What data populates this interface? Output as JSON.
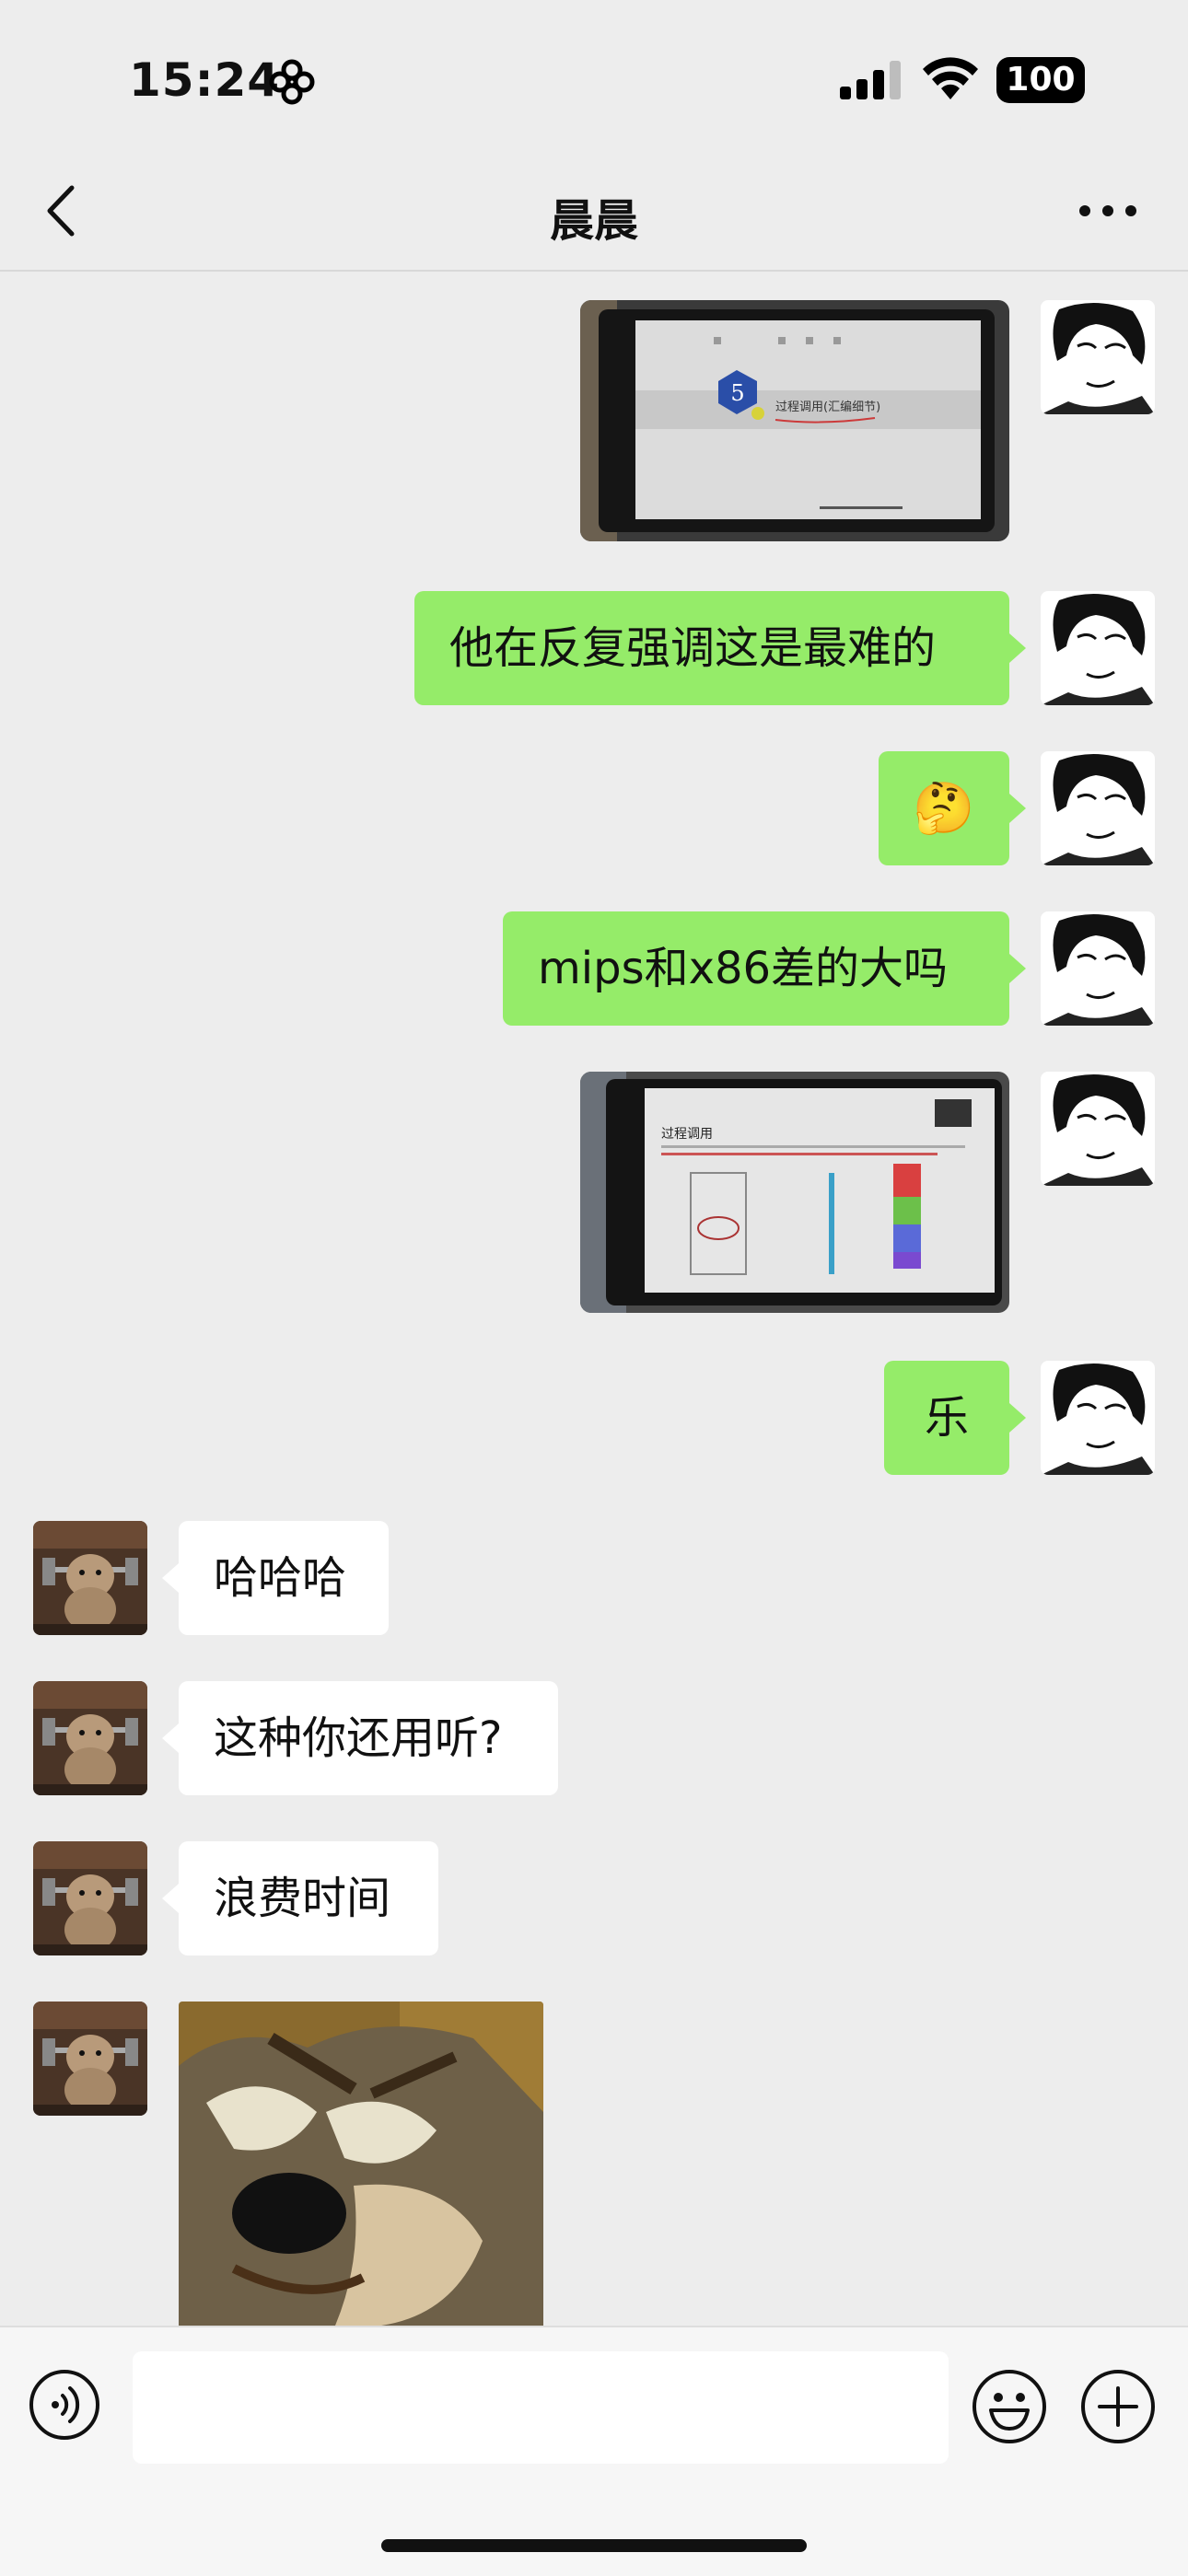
{
  "status_bar": {
    "time": "15:24",
    "battery": "100",
    "icons": [
      "focus-flower-icon",
      "cellular-signal-icon",
      "wifi-icon",
      "battery-icon"
    ]
  },
  "nav": {
    "title": "晨晨",
    "icons": [
      "back-chevron-icon",
      "more-dots-icon"
    ]
  },
  "colors": {
    "background": "#ededed",
    "outgoing_bubble": "#95ec69",
    "incoming_bubble": "#ffffff",
    "input_bar": "#f6f6f6"
  },
  "messages": [
    {
      "direction": "out",
      "type": "image",
      "content": "photo of tablet slide with hexagon 5"
    },
    {
      "direction": "out",
      "type": "text",
      "text": "他在反复强调这是最难的"
    },
    {
      "direction": "out",
      "type": "emoji",
      "text": "🤔"
    },
    {
      "direction": "out",
      "type": "text",
      "text": "mips和x86差的大吗"
    },
    {
      "direction": "out",
      "type": "image",
      "content": "photo of tablet slide 过程调用"
    },
    {
      "direction": "out",
      "type": "text",
      "text": "乐"
    },
    {
      "direction": "in",
      "type": "text",
      "text": "哈哈哈"
    },
    {
      "direction": "in",
      "type": "text",
      "text": "这种你还用听?"
    },
    {
      "direction": "in",
      "type": "text",
      "text": "浪费时间"
    },
    {
      "direction": "in",
      "type": "image",
      "content": "cartoon cat sticker"
    }
  ],
  "slide1": {
    "number": "5",
    "title": "过程调用(汇编细节)"
  },
  "slide2": {
    "title": "过程调用"
  },
  "input_bar": {
    "placeholder": "",
    "icons": [
      "voice-icon",
      "emoji-icon",
      "plus-icon"
    ]
  }
}
